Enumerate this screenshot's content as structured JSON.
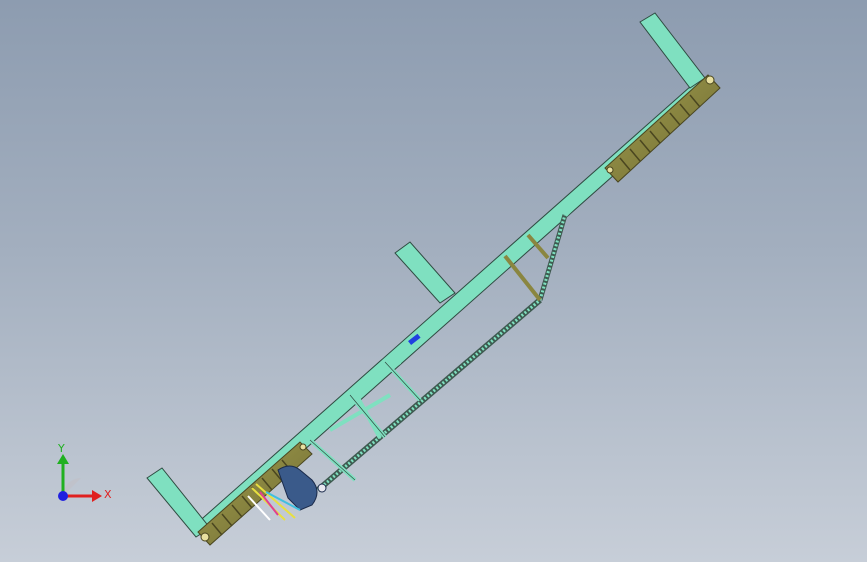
{
  "viewport": {
    "background_top": "#8d9cb0",
    "background_bottom": "#c7ced8"
  },
  "model": {
    "frame_color": "#7fe0c0",
    "frame_edge_color": "#2e4a40",
    "tread_color": "#8a8640",
    "tread_dark_color": "#4a4620",
    "bracket_color": "#3a5a8a",
    "hydraulic_colors": [
      "#e8e040",
      "#e04090",
      "#40c0e0",
      "#ffffff"
    ],
    "marker_color": "#2040e0"
  },
  "triad": {
    "x_label": "X",
    "y_label": "Y",
    "x_color": "#e02020",
    "y_color": "#20b020",
    "z_color": "#2020e0",
    "icon": "coordinate-triad-icon"
  }
}
